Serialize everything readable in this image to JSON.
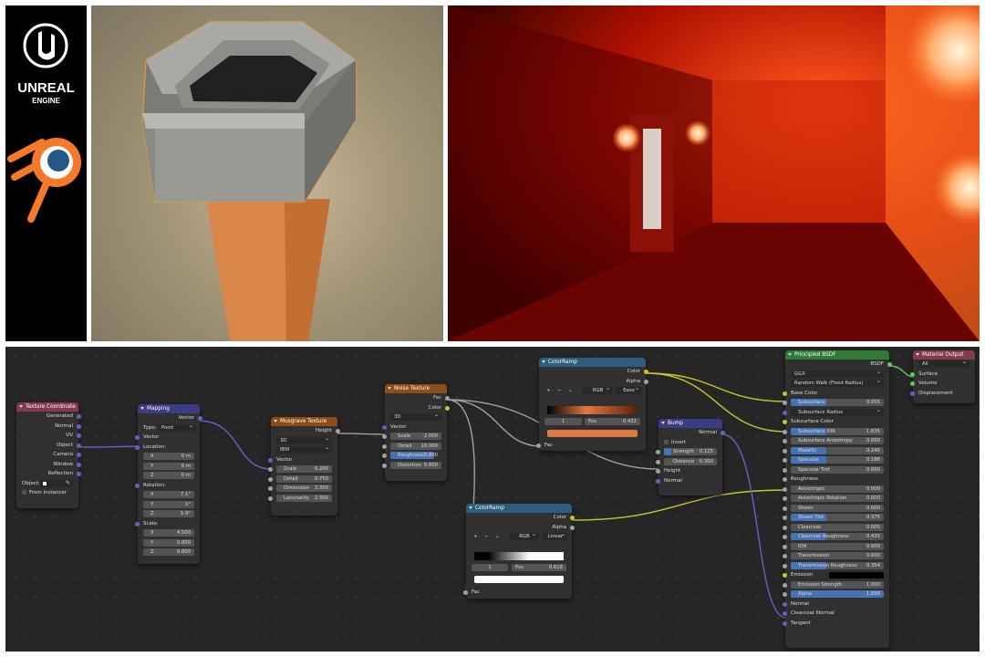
{
  "logos": {
    "unreal_line1": "UNREAL",
    "unreal_line2": "ENGINE"
  },
  "colors": {
    "vector_socket": "#6363c7",
    "color_socket": "#c7c729",
    "float_socket": "#a1a1a1",
    "shader_socket": "#63c763",
    "selected_field": "#4772b3"
  },
  "nodes": {
    "texcoord": {
      "title": "Texture Coordinate",
      "outputs": [
        "Generated",
        "Normal",
        "UV",
        "Object",
        "Camera",
        "Window",
        "Reflection"
      ],
      "object_label": "Object:",
      "from_instancer": "From Instancer"
    },
    "mapping": {
      "title": "Mapping",
      "out": "Vector",
      "type_label": "Type:",
      "type_value": "Point",
      "in_vector": "Vector",
      "location": "Location:",
      "loc": [
        [
          "X",
          "0 m"
        ],
        [
          "Y",
          "0 m"
        ],
        [
          "Z",
          "0 m"
        ]
      ],
      "rotation": "Rotation:",
      "rot": [
        [
          "X",
          "7.1°"
        ],
        [
          "Y",
          "1°"
        ],
        [
          "Z",
          "5.9°"
        ]
      ],
      "scale": "Scale:",
      "sc": [
        [
          "X",
          "4.500"
        ],
        [
          "Y",
          "0.800"
        ],
        [
          "Z",
          "0.800"
        ]
      ]
    },
    "musgrave": {
      "title": "Musgrave Texture",
      "out": "Height",
      "dim": "3D",
      "type": "fBM",
      "in_vector": "Vector",
      "fields": [
        [
          "Scale",
          "0.200"
        ],
        [
          "Detail",
          "0.750"
        ],
        [
          "Dimension",
          "3.300"
        ],
        [
          "Lacunarity",
          "2.500"
        ]
      ]
    },
    "noise": {
      "title": "Noise Texture",
      "out_fac": "Fac",
      "out_color": "Color",
      "dim": "3D",
      "in_vector": "Vector",
      "fields": [
        [
          "Scale",
          "2.000"
        ],
        [
          "Detail",
          "18.000"
        ],
        [
          "Roughness",
          "0.800"
        ],
        [
          "Distortion",
          "0.800"
        ]
      ]
    },
    "ramp1": {
      "title": "ColorRamp",
      "out_color": "Color",
      "out_alpha": "Alpha",
      "mode": "RGB",
      "interp": "Ease",
      "index": "1",
      "pos_label": "Pos",
      "pos_value": "0.432",
      "in_fac": "Fac"
    },
    "ramp2": {
      "title": "ColorRamp",
      "out_color": "Color",
      "out_alpha": "Alpha",
      "mode": "RGB",
      "interp": "Linear",
      "index": "1",
      "pos_label": "Pos",
      "pos_value": "0.618",
      "in_fac": "Fac"
    },
    "bump": {
      "title": "Bump",
      "out": "Normal",
      "invert": "Invert",
      "fields": [
        [
          "Strength",
          "0.125"
        ],
        [
          "Distance",
          "0.300"
        ]
      ],
      "in_height": "Height",
      "in_normal": "Normal"
    },
    "bsdf": {
      "title": "Principled BSDF",
      "out": "BSDF",
      "distribution": "GGX",
      "sss_method": "Random Walk (Fixed Radius)",
      "base_color": "Base Color",
      "rows": [
        [
          "Subsurface",
          "0.055"
        ],
        [
          "Subsurface Radius",
          ""
        ],
        [
          "Subsurface Color",
          ""
        ],
        [
          "Subsurface IOR",
          "1.835"
        ],
        [
          "Subsurface Anisotropy",
          "0.000"
        ],
        [
          "Metallic",
          "0.245"
        ],
        [
          "Specular",
          "0.186"
        ],
        [
          "Specular Tint",
          "0.000"
        ],
        [
          "Roughness",
          ""
        ],
        [
          "Anisotropic",
          "0.000"
        ],
        [
          "Anisotropic Rotation",
          "0.000"
        ],
        [
          "Sheen",
          "0.000"
        ],
        [
          "Sheen Tint",
          "0.375"
        ],
        [
          "Clearcoat",
          "0.005"
        ],
        [
          "Clearcoat Roughness",
          "0.435"
        ],
        [
          "IOR",
          "0.000"
        ],
        [
          "Transmission",
          "0.000"
        ],
        [
          "Transmission Roughness",
          "0.354"
        ],
        [
          "Emission",
          ""
        ],
        [
          "Emission Strength",
          "1.000"
        ],
        [
          "Alpha",
          "1.000"
        ],
        [
          "Normal",
          ""
        ],
        [
          "Clearcoat Normal",
          ""
        ],
        [
          "Tangent",
          ""
        ]
      ]
    },
    "output": {
      "title": "Material Output",
      "target": "All",
      "inputs": [
        "Surface",
        "Volume",
        "Displacement"
      ]
    }
  }
}
